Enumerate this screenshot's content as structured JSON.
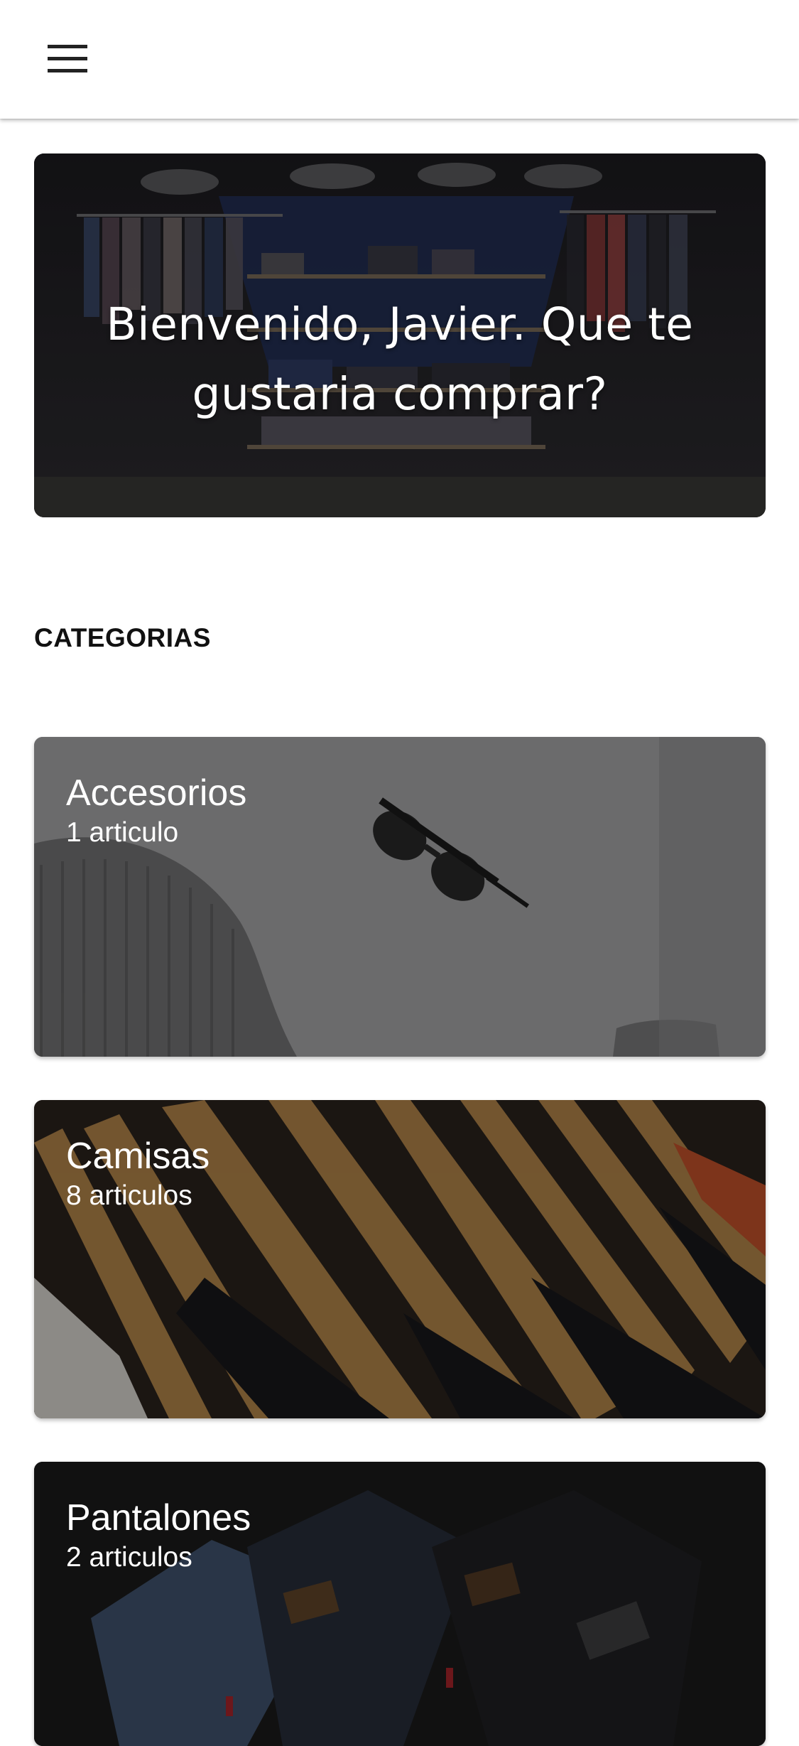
{
  "app_bar": {
    "menu_icon": "hamburger-menu-icon"
  },
  "hero": {
    "title": "Bienvenido, Javier. Que te gustaria comprar?",
    "image": "clothing-store-interior-photo"
  },
  "categories_section": {
    "heading": "CATEGORIAS",
    "items": [
      {
        "name": "Accesorios",
        "count": "1 articulo",
        "image": "sunglasses-and-knit-sweater-photo"
      },
      {
        "name": "Camisas",
        "count": "8 articulos",
        "image": "shirts-on-wooden-hangers-photo"
      },
      {
        "name": "Pantalones",
        "count": "2 articulos",
        "image": "folded-jeans-photo"
      }
    ]
  },
  "colors": {
    "app_bar_background": "#ffffff",
    "heading_text": "#111111",
    "card_text": "#ffffff"
  }
}
